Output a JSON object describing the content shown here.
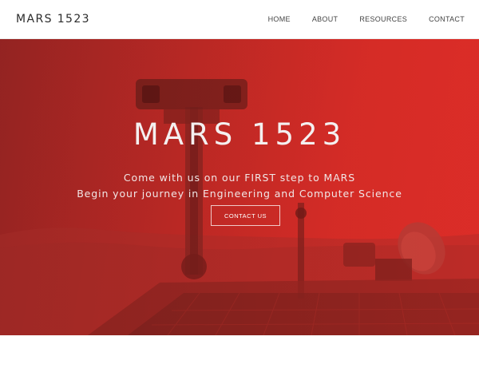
{
  "navbar": {
    "brand": "MARS 1523",
    "links": [
      "HOME",
      "ABOUT",
      "RESOURCES",
      "CONTACT"
    ]
  },
  "hero": {
    "title": "MARS 1523",
    "line1": "Come with us on our FIRST step to MARS",
    "line2": "Begin your journey in Engineering and Computer Science",
    "cta_label": "CONTACT US",
    "image_subject": "mars-rover-illustration"
  },
  "colors": {
    "hero_red": "#d42e28",
    "hero_dark": "#8f2624",
    "nav_text": "#444444",
    "brand_text": "#2b2b2b"
  }
}
